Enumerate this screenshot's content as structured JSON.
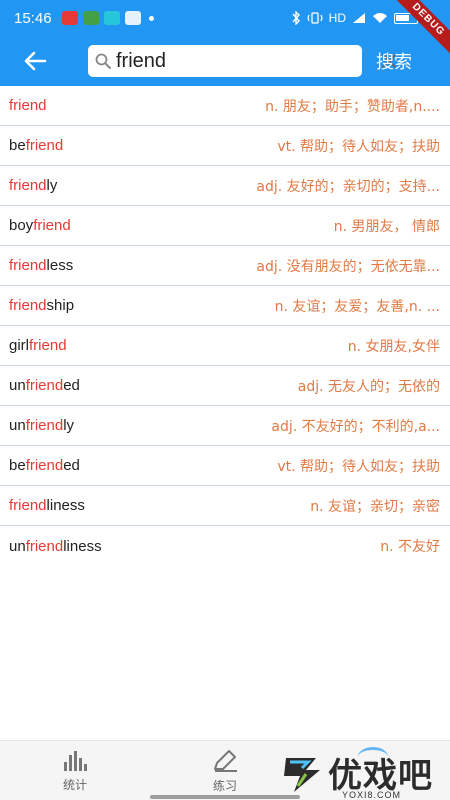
{
  "status_bar": {
    "time": "15:46",
    "network": "HD",
    "icons": [
      "record-icon",
      "chat-icon",
      "message-icon",
      "cloud-icon",
      "dot-icon",
      "bluetooth-icon",
      "vibrate-icon",
      "signal-icon",
      "wifi-icon",
      "battery-icon"
    ]
  },
  "debug_banner": "DEBUG",
  "app_bar": {
    "back_icon": "arrow-left-icon",
    "search": {
      "value": "friend",
      "placeholder": ""
    },
    "search_button": "搜索"
  },
  "colors": {
    "primary": "#2196f3",
    "highlight": "#e53935",
    "meaning": "#e07a45",
    "divider": "#c8d6e6"
  },
  "results": [
    {
      "pre": "",
      "match": "friend",
      "post": "",
      "meaning": "n. 朋友；助手；赞助者,n...."
    },
    {
      "pre": "be",
      "match": "friend",
      "post": "",
      "meaning": "vt. 帮助；待人如友；扶助"
    },
    {
      "pre": "",
      "match": "friend",
      "post": "ly",
      "meaning": "adj. 友好的；亲切的；支持..."
    },
    {
      "pre": "boy",
      "match": "friend",
      "post": "",
      "meaning": "n. 男朋友， 情郎"
    },
    {
      "pre": "",
      "match": "friend",
      "post": "less",
      "meaning": "adj. 没有朋友的；无依无靠..."
    },
    {
      "pre": "",
      "match": "friend",
      "post": "ship",
      "meaning": "n. 友谊；友爱；友善,n. ..."
    },
    {
      "pre": "girl",
      "match": "friend",
      "post": "",
      "meaning": "n. 女朋友,女伴"
    },
    {
      "pre": "un",
      "match": "friend",
      "post": "ed",
      "meaning": "adj. 无友人的；无依的"
    },
    {
      "pre": "un",
      "match": "friend",
      "post": "ly",
      "meaning": "adj. 不友好的；不利的,a..."
    },
    {
      "pre": "be",
      "match": "friend",
      "post": "ed",
      "meaning": "vt. 帮助；待人如友；扶助"
    },
    {
      "pre": "",
      "match": "friend",
      "post": "liness",
      "meaning": "n. 友谊；亲切；亲密"
    },
    {
      "pre": "un",
      "match": "friend",
      "post": "liness",
      "meaning": "n. 不友好"
    }
  ],
  "bottom_nav": [
    {
      "label": "统计",
      "icon": "bar-chart-icon"
    },
    {
      "label": "练习",
      "icon": "pencil-icon"
    }
  ],
  "watermark": {
    "text": "优戏吧",
    "url": "YOXI8.COM"
  }
}
